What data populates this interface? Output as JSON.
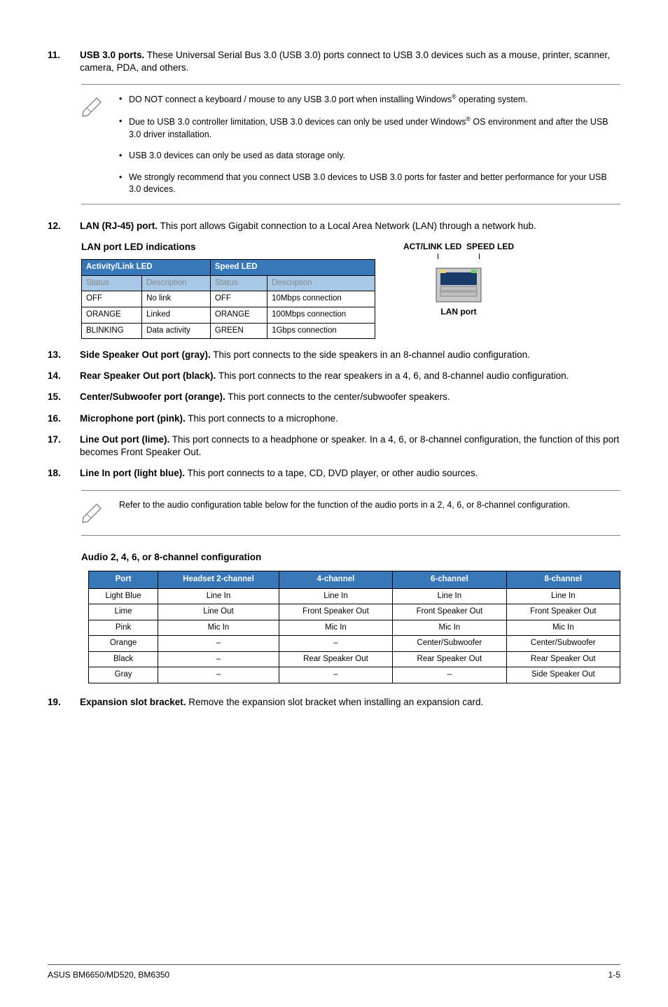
{
  "items": {
    "n11": "11.",
    "t11a": "USB 3.0 ports.",
    "t11b": " These Universal Serial Bus 3.0 (USB 3.0) ports connect to USB 3.0 devices such as a mouse, printer, scanner, camera, PDA, and others.",
    "n12": "12.",
    "t12a": "LAN (RJ-45) port.",
    "t12b": " This port allows Gigabit connection to a Local Area Network (LAN) through a network hub.",
    "n13": "13.",
    "t13a": "Side Speaker Out port (gray).",
    "t13b": " This port connects to the side speakers in an 8-channel audio configuration.",
    "n14": "14.",
    "t14a": "Rear Speaker Out port (black).",
    "t14b": " This port connects to the rear speakers in a 4, 6, and 8-channel audio configuration.",
    "n15": "15.",
    "t15a": "Center/Subwoofer port (orange).",
    "t15b": " This port connects to the center/subwoofer speakers.",
    "n16": "16.",
    "t16a": "Microphone port (pink).",
    "t16b": " This port connects to a microphone.",
    "n17": "17.",
    "t17a": "Line Out port (lime).",
    "t17b": " This port connects to a headphone or speaker. In a 4, 6, or 8-channel configuration, the function of this port becomes Front Speaker Out.",
    "n18": "18.",
    "t18a": "Line In port (light blue).",
    "t18b": " This port connects to a tape, CD, DVD player, or other audio sources.",
    "n19": "19.",
    "t19a": "Expansion slot bracket.",
    "t19b": " Remove the expansion slot bracket when installing an expansion card."
  },
  "notes1": {
    "b1a": "DO NOT connect a keyboard / mouse to any USB 3.0 port when installing Windows",
    "b1b": " operating system.",
    "b2a": "Due to USB 3.0 controller limitation, USB 3.0 devices can only be used under Windows",
    "b2b": " OS environment and after the USB 3.0 driver installation.",
    "b3": "USB 3.0 devices can only be used as data storage only.",
    "b4": "We strongly recommend that you connect USB 3.0 devices to USB 3.0 ports for faster and better performance for your USB 3.0 devices."
  },
  "notes2": "Refer to the audio configuration table below for the function of the audio ports in a 2, 4, 6, or 8-channel configuration.",
  "lan": {
    "heading": "LAN port LED indications",
    "top_act": "ACT/LINK LED",
    "top_speed": "SPEED LED",
    "port_label": "LAN port",
    "band1": "Activity/Link LED",
    "band2": "Speed LED",
    "sub_status": "Status",
    "sub_desc": "Description",
    "r1c1": "OFF",
    "r1c2": "No link",
    "r1c3": "OFF",
    "r1c4": "10Mbps connection",
    "r2c1": "ORANGE",
    "r2c2": "Linked",
    "r2c3": "ORANGE",
    "r2c4": "100Mbps connection",
    "r3c1": "BLINKING",
    "r3c2": "Data activity",
    "r3c3": "GREEN",
    "r3c4": "1Gbps connection"
  },
  "audio": {
    "heading": "Audio 2, 4, 6, or 8-channel configuration",
    "h1": "Port",
    "h2": "Headset 2-channel",
    "h3": "4-channel",
    "h4": "6-channel",
    "h5": "8-channel",
    "rows": [
      [
        "Light Blue",
        "Line In",
        "Line In",
        "Line In",
        "Line In"
      ],
      [
        "Lime",
        "Line Out",
        "Front Speaker Out",
        "Front Speaker Out",
        "Front Speaker Out"
      ],
      [
        "Pink",
        "Mic In",
        "Mic In",
        "Mic In",
        "Mic In"
      ],
      [
        "Orange",
        "–",
        "–",
        "Center/Subwoofer",
        "Center/Subwoofer"
      ],
      [
        "Black",
        "–",
        "Rear Speaker Out",
        "Rear Speaker Out",
        "Rear Speaker Out"
      ],
      [
        "Gray",
        "–",
        "–",
        "–",
        "Side Speaker Out"
      ]
    ]
  },
  "footer": {
    "left": "ASUS BM6650/MD520, BM6350",
    "right": "1-5"
  },
  "reg": "®"
}
